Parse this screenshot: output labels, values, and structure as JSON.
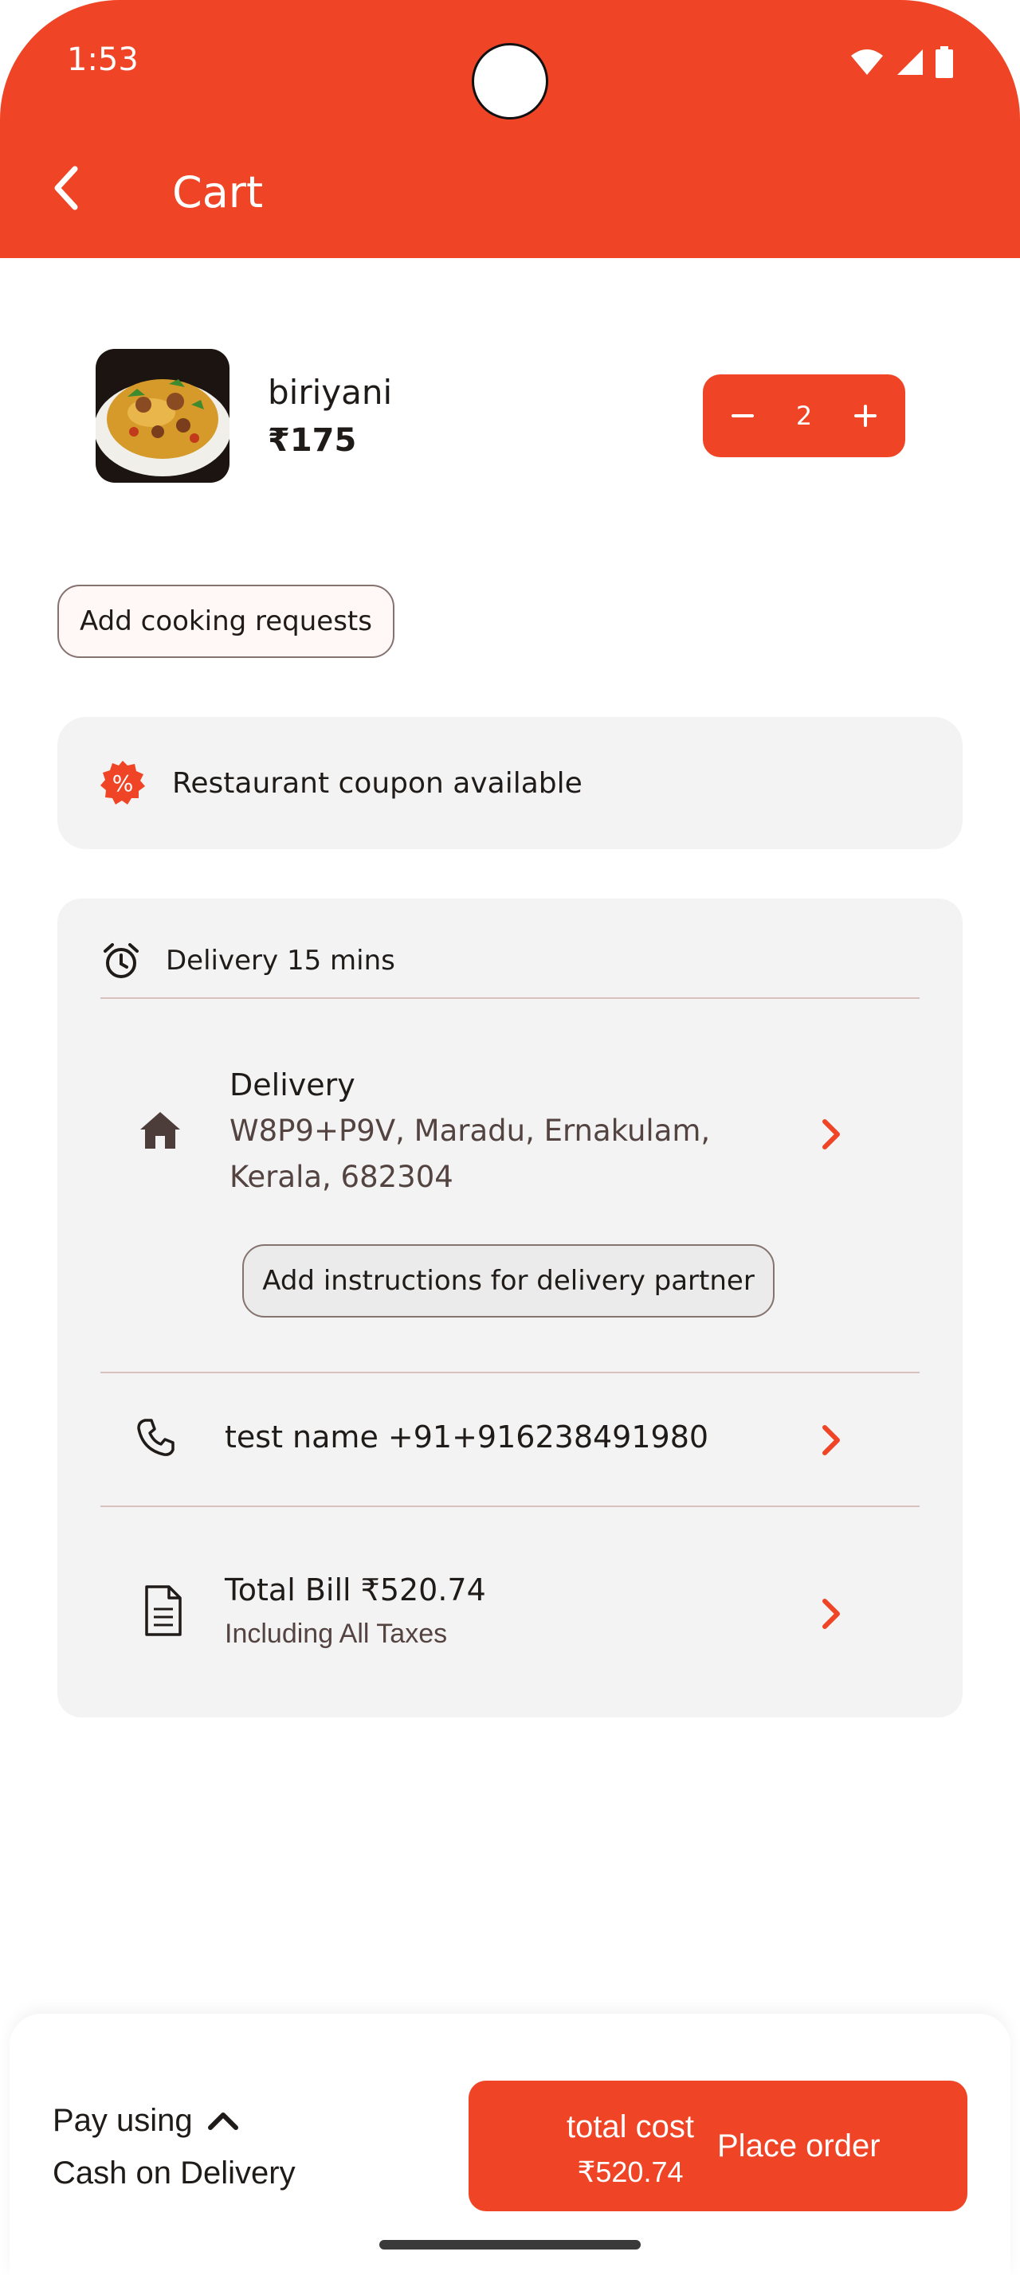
{
  "status_bar": {
    "time": "1:53"
  },
  "app_bar": {
    "title": "Cart"
  },
  "cart_item": {
    "name": "biriyani",
    "price": "₹175",
    "quantity": "2"
  },
  "cooking_requests": {
    "label": "Add cooking requests"
  },
  "coupon": {
    "text": "Restaurant coupon available"
  },
  "delivery": {
    "eta": "Delivery 15 mins",
    "title": "Delivery",
    "address_line1": "W8P9+P9V, Maradu, Ernakulam,",
    "address_line2": "Kerala, 682304",
    "instructions_label": "Add instructions for delivery partner"
  },
  "contact": {
    "text": "test name +91+916238491980"
  },
  "bill": {
    "title": "Total Bill ₹520.74",
    "subtitle": "Including All Taxes"
  },
  "footer": {
    "pay_using": "Pay using",
    "payment_method": "Cash on Delivery",
    "total_label": "total cost",
    "total_value": "₹520.74",
    "place_order": "Place order"
  },
  "colors": {
    "accent": "#ef4426",
    "card": "#f4f3f3",
    "divider": "#d8c2bd"
  },
  "icons": [
    "wifi-icon",
    "signal-icon",
    "battery-icon",
    "back-arrow-icon",
    "minus-icon",
    "plus-icon",
    "discount-icon",
    "alarm-icon",
    "home-icon",
    "chevron-right-icon",
    "phone-icon",
    "receipt-icon",
    "chevron-up-icon"
  ]
}
